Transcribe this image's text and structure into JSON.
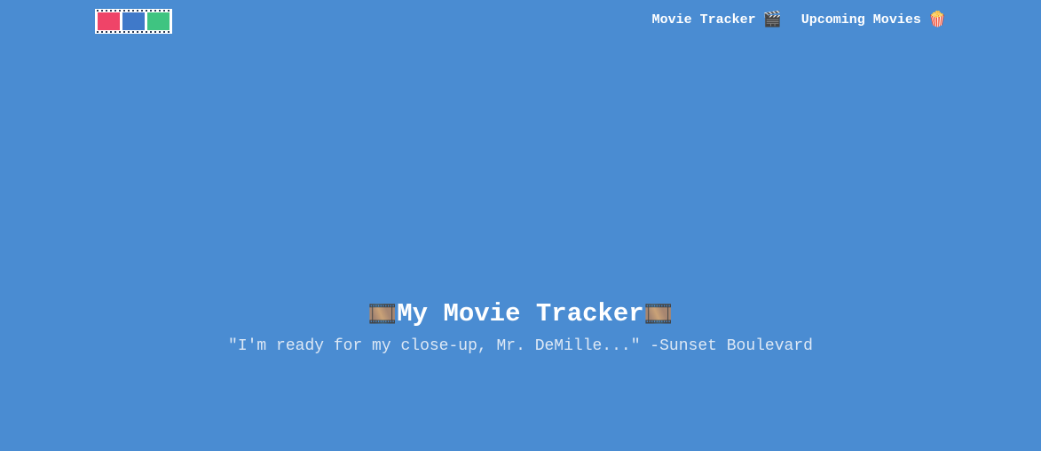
{
  "navbar": {
    "logo": {
      "colors": [
        "#ef4468",
        "#3f79c9",
        "#3fc481"
      ]
    },
    "links": [
      {
        "label": "Movie Tracker",
        "icon": "clapper-board-icon",
        "emoji": "🎬"
      },
      {
        "label": "Upcoming Movies",
        "icon": "popcorn-icon",
        "emoji": "🍿"
      }
    ]
  },
  "hero": {
    "title": "My Movie Tracker",
    "title_icon": "film-frames-icon",
    "title_emoji": "🎞️",
    "quote": "\"I'm ready for my close-up, Mr. DeMille...\" -Sunset Boulevard"
  },
  "colors": {
    "background": "#4a8cd2"
  }
}
